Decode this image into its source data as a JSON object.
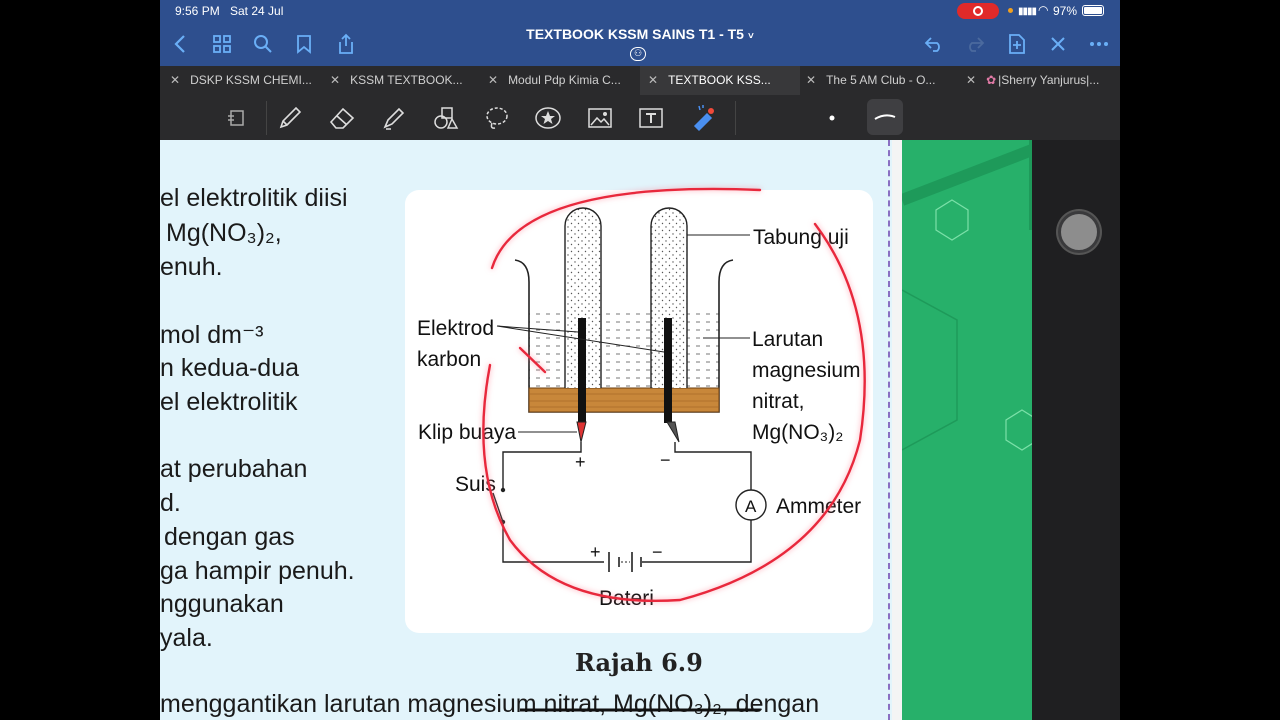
{
  "status_bar": {
    "time": "9:56 PM",
    "date": "Sat 24 Jul",
    "battery": "97%"
  },
  "nav": {
    "title": "TEXTBOOK KSSM SAINS T1 - T5",
    "chevron": "˅"
  },
  "tabs": [
    {
      "label": "DSKP KSSM CHEMI..."
    },
    {
      "label": "KSSM TEXTBOOK..."
    },
    {
      "label": "Modul Pdp Kimia  C..."
    },
    {
      "label": "TEXTBOOK KSS..."
    },
    {
      "label": "The 5 AM Club - O..."
    },
    {
      "label": "|Sherry Yanjurus|..."
    }
  ],
  "page_text": {
    "lines": [
      "el elektrolitik diisi",
      "Mg(NO₃)₂,",
      "enuh.",
      "mol dm⁻³",
      "n kedua-dua",
      "el elektrolitik",
      "at perubahan",
      "d.",
      "dengan gas",
      "ga hampir penuh.",
      "nggunakan",
      "yala.",
      "menggantikan larutan magnesium nitrat, Mg(NO₃)₂, dengan"
    ],
    "caption": "Rajah 6.9"
  },
  "figure": {
    "labels": {
      "tabung_uji": "Tabung uji",
      "elektrod": "Elektrod",
      "karbon": "karbon",
      "larutan": "Larutan",
      "magnesium": "magnesium",
      "nitrat": "nitrat,",
      "formula": "Mg(NO₃)₂",
      "klip": "Klip buaya",
      "suis": "Suis",
      "ammeter": "Ammeter",
      "ammeter_symbol": "A",
      "bateri": "Bateri",
      "plus": "+",
      "minus": "−"
    }
  },
  "colors": {
    "nav_bg": "#2e4f8e",
    "accent_icon": "#6aaff7",
    "page_bg": "#e2f4fb",
    "annotation": "#e8283c",
    "green_panel": "#27b06a"
  }
}
